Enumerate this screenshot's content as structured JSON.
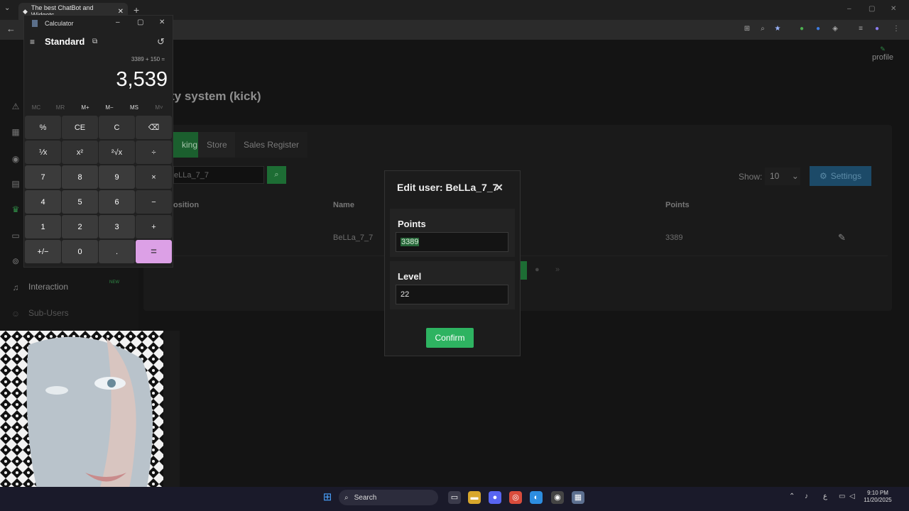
{
  "browser": {
    "tab_title": "The best ChatBot and Widgets",
    "tab_close": "✕",
    "new_tab": "+",
    "tab_menu": "⌄",
    "window_controls": [
      "–",
      "▢",
      "✕"
    ]
  },
  "sidebar": {
    "interaction_label": "Interaction",
    "interaction_badge": "NEW",
    "subusers_label": "Sub-Users"
  },
  "header": {
    "profile_label": "profile"
  },
  "page": {
    "title_fragment": "ty system (kick)",
    "tabs": [
      {
        "label": "king"
      },
      {
        "label": "Store"
      },
      {
        "label": "Sales Register"
      }
    ],
    "search_value": "eLLa_7_7",
    "show_label": "Show:",
    "show_value": "10",
    "settings_label": "Settings",
    "columns": [
      "osition",
      "Name",
      "Points"
    ],
    "row": {
      "name": "BeLLa_7_7",
      "points": "3389"
    }
  },
  "modal": {
    "title": "Edit user: BeLLa_7_7",
    "close": "✕",
    "points_label": "Points",
    "points_value": "3389",
    "level_label": "Level",
    "level_value": "22",
    "confirm_label": "Confirm"
  },
  "calculator": {
    "title": "Calculator",
    "mode": "Standard",
    "expression": "3389 + 150 =",
    "result": "3,539",
    "window_controls": [
      "–",
      "▢",
      "✕"
    ],
    "memory": [
      "MC",
      "MR",
      "M+",
      "M−",
      "MS",
      "M˅"
    ],
    "keys": [
      [
        "%",
        "CE",
        "C",
        "⌫"
      ],
      [
        "⅟x",
        "x²",
        "²√x",
        "÷"
      ],
      [
        "7",
        "8",
        "9",
        "×"
      ],
      [
        "4",
        "5",
        "6",
        "−"
      ],
      [
        "1",
        "2",
        "3",
        "+"
      ],
      [
        "+/−",
        "0",
        ".",
        "="
      ]
    ]
  },
  "taskbar": {
    "search_label": "Search",
    "time": "9:10 PM",
    "date": "11/20/2025",
    "lang": "ع"
  },
  "colors": {
    "accent_green": "#2eb361",
    "calc_equals": "#dca0e6",
    "settings_blue": "#1c4a68"
  }
}
